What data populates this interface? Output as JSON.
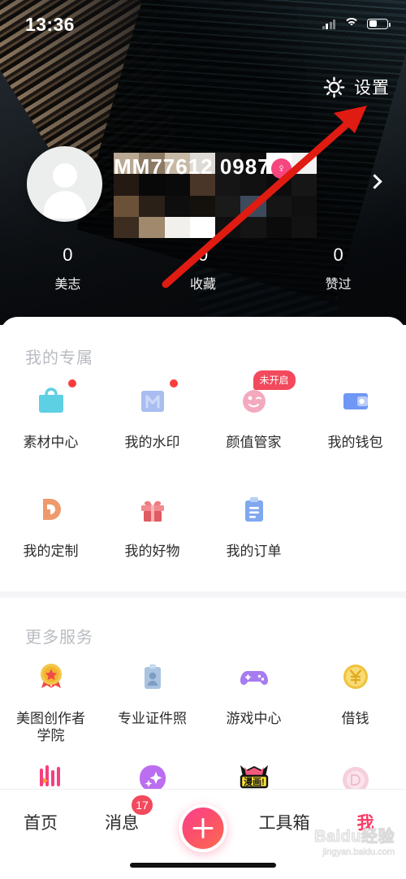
{
  "statusbar": {
    "time": "13:36",
    "signal_icon": "signal-bars-icon",
    "wifi_icon": "wifi-icon",
    "battery_icon": "battery-icon"
  },
  "header": {
    "settings_label": "设置",
    "settings_icon": "gear-icon",
    "annotation_arrow": "red-arrow-pointing-to-settings"
  },
  "profile": {
    "avatar_icon": "default-avatar-icon",
    "username": "MM77612 0987",
    "username_masked": true,
    "gender_icon": "female-gender-icon",
    "gender_color": "#f5467f",
    "chevron_icon": "chevron-right-icon",
    "stats": [
      {
        "value": "0",
        "label": "美志"
      },
      {
        "value": "0",
        "label": "收藏"
      },
      {
        "value": "0",
        "label": "赞过"
      }
    ]
  },
  "exclusive": {
    "title": "我的专属",
    "items": [
      {
        "label": "素材中心",
        "icon": "shopping-bag-icon",
        "color": "#5bd2e6",
        "badge_dot": true
      },
      {
        "label": "我的水印",
        "icon": "watermark-m-icon",
        "color": "#a8bdf0",
        "badge_dot": true
      },
      {
        "label": "颜值管家",
        "icon": "beauty-face-icon",
        "color": "#f3a8bd",
        "badge_text": "未开启"
      },
      {
        "label": "我的钱包",
        "icon": "wallet-icon",
        "color": "#6f97f5"
      },
      {
        "label": "我的定制",
        "icon": "custom-d-icon",
        "color": "#ef9a6d"
      },
      {
        "label": "我的好物",
        "icon": "gift-box-icon",
        "color": "#e6575f"
      },
      {
        "label": "我的订单",
        "icon": "order-clipboard-icon",
        "color": "#7fa8ef"
      }
    ]
  },
  "more_services": {
    "title": "更多服务",
    "items": [
      {
        "label": "美图创作者\n学院",
        "icon": "medal-star-icon",
        "color": "#f4c64a"
      },
      {
        "label": "专业证件照",
        "icon": "id-photo-icon",
        "color": "#a9c3e0"
      },
      {
        "label": "游戏中心",
        "icon": "gamepad-icon",
        "color": "#a77cf0"
      },
      {
        "label": "借钱",
        "icon": "yen-coin-icon",
        "color": "#f5cf55"
      }
    ],
    "partial_row_icons": [
      {
        "icon": "vlog-pink-icon",
        "color": "#f63f7f"
      },
      {
        "icon": "sparkle-purple-icon",
        "color": "#bb6ef0"
      },
      {
        "icon": "manga-comic-icon",
        "color": "#f7e032"
      },
      {
        "icon": "pearl-pink-icon",
        "color": "#f4c5d4"
      }
    ]
  },
  "bottomnav": {
    "items": [
      {
        "label": "首页",
        "active": false
      },
      {
        "label": "消息",
        "active": false,
        "badge": "17"
      },
      {
        "label": "工具箱",
        "active": false
      },
      {
        "label": "我",
        "active": true
      }
    ],
    "fab_icon": "plus-icon",
    "active_color": "#fb3a65"
  },
  "watermark": {
    "main": "Baidu经验",
    "sub": "jingyan.baidu.com"
  }
}
